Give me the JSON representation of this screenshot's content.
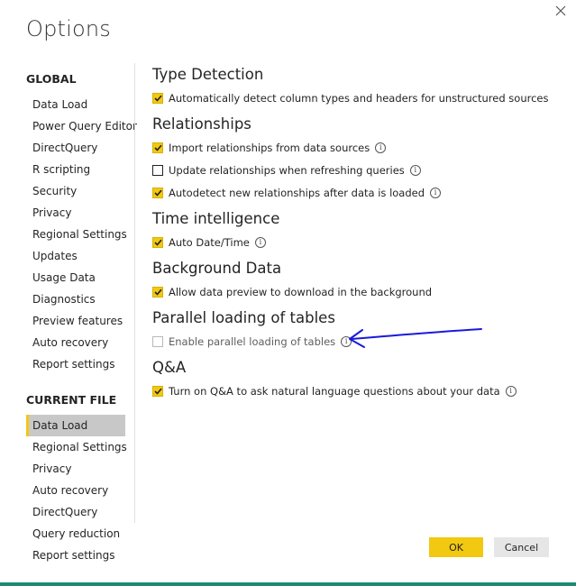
{
  "dialog": {
    "title": "Options"
  },
  "sidebar": {
    "global_heading": "GLOBAL",
    "global_items": [
      {
        "label": "Data Load"
      },
      {
        "label": "Power Query Editor"
      },
      {
        "label": "DirectQuery"
      },
      {
        "label": "R scripting"
      },
      {
        "label": "Security"
      },
      {
        "label": "Privacy"
      },
      {
        "label": "Regional Settings"
      },
      {
        "label": "Updates"
      },
      {
        "label": "Usage Data"
      },
      {
        "label": "Diagnostics"
      },
      {
        "label": "Preview features"
      },
      {
        "label": "Auto recovery"
      },
      {
        "label": "Report settings"
      }
    ],
    "current_file_heading": "CURRENT FILE",
    "current_file_items": [
      {
        "label": "Data Load",
        "selected": true
      },
      {
        "label": "Regional Settings"
      },
      {
        "label": "Privacy"
      },
      {
        "label": "Auto recovery"
      },
      {
        "label": "DirectQuery"
      },
      {
        "label": "Query reduction"
      },
      {
        "label": "Report settings"
      }
    ]
  },
  "main": {
    "type_detection": {
      "title": "Type Detection",
      "options": [
        {
          "label": "Automatically detect column types and headers for unstructured sources",
          "checked": true,
          "info": false
        }
      ]
    },
    "relationships": {
      "title": "Relationships",
      "options": [
        {
          "label": "Import relationships from data sources",
          "checked": true,
          "info": true
        },
        {
          "label": "Update relationships when refreshing queries",
          "checked": false,
          "info": true
        },
        {
          "label": "Autodetect new relationships after data is loaded",
          "checked": true,
          "info": true
        }
      ]
    },
    "time_intelligence": {
      "title": "Time intelligence",
      "options": [
        {
          "label": "Auto Date/Time",
          "checked": true,
          "info": true
        }
      ]
    },
    "background_data": {
      "title": "Background Data",
      "options": [
        {
          "label": "Allow data preview to download in the background",
          "checked": true,
          "info": false
        }
      ]
    },
    "parallel_loading": {
      "title": "Parallel loading of tables",
      "options": [
        {
          "label": "Enable parallel loading of tables",
          "checked": false,
          "disabled": true,
          "info": true
        }
      ]
    },
    "qa": {
      "title": "Q&A",
      "options": [
        {
          "label": "Turn on Q&A to ask natural language questions about your data",
          "checked": true,
          "info": true
        }
      ]
    }
  },
  "footer": {
    "ok_label": "OK",
    "cancel_label": "Cancel"
  },
  "icons": {
    "close": "close-icon",
    "info": "info-icon",
    "checkmark": "checkmark-icon"
  },
  "colors": {
    "accent": "#f2c811",
    "selected_bg": "#c8c8c8",
    "annotation_arrow": "#1a1adb",
    "bottom_strip": "#1e8a74"
  }
}
